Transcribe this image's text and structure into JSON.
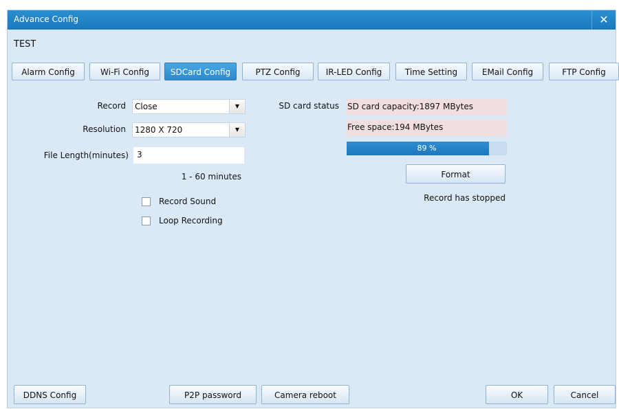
{
  "window": {
    "title": "Advance Config",
    "close": "✕"
  },
  "device_name": "TEST",
  "tabs": [
    {
      "label": "Alarm Config"
    },
    {
      "label": "Wi-Fi Config"
    },
    {
      "label": "SDCard Config",
      "active": true
    },
    {
      "label": "PTZ Config"
    },
    {
      "label": "IR-LED Config"
    },
    {
      "label": "Time Setting"
    },
    {
      "label": "EMail Config"
    },
    {
      "label": "FTP Config"
    }
  ],
  "form": {
    "record_label": "Record",
    "record_value": "Close",
    "resolution_label": "Resolution",
    "resolution_value": "1280 X 720",
    "file_length_label": "File Length(minutes)",
    "file_length_value": "3",
    "range_hint": "1 - 60 minutes",
    "record_sound_label": "Record Sound",
    "loop_recording_label": "Loop Recording"
  },
  "sd_status": {
    "label": "SD card status",
    "capacity": "SD card capacity:1897 MBytes",
    "free_space": "Free space:194 MBytes",
    "usage_percent": 89,
    "usage_text": "89 %",
    "format_label": "Format",
    "record_state": "Record has stopped"
  },
  "footer": {
    "ddns": "DDNS Config",
    "p2p": "P2P password",
    "reboot": "Camera reboot",
    "ok": "OK",
    "cancel": "Cancel"
  },
  "colors": {
    "titlebar": "#1b78bd",
    "active_tab": "#2c89cb",
    "progress": "#1f76bb",
    "window_bg": "#dbe9f6"
  }
}
